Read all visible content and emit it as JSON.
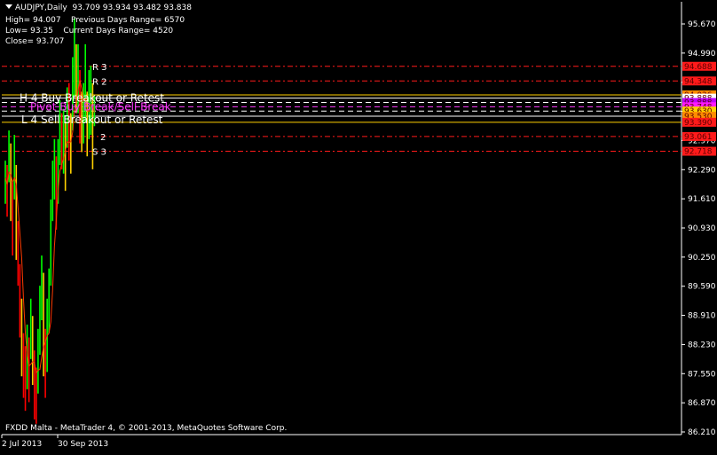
{
  "chart_data": {
    "type": "candlestick",
    "symbol_label": "AUDJPY,Daily",
    "ohlc_header": "93.709 93.934 93.482 93.838",
    "info": {
      "high": "High= 94.007",
      "prev_range": "Previous Days Range= 6570",
      "low": "Low= 93.35",
      "curr_range": "Current Days Range= 4520",
      "close": "Close= 93.707"
    },
    "footer": "FXDD Malta - MetaTrader 4, © 2001-2013, MetaQuotes Software Corp.",
    "x_tick_labels": [
      "2 Jul 2013",
      "30 Sep 2013"
    ],
    "y_ticks": [
      "95.670",
      "94.990",
      "94.310",
      "93.630",
      "92.970",
      "92.290",
      "91.610",
      "90.930",
      "90.250",
      "89.590",
      "88.910",
      "88.230",
      "87.550",
      "86.870",
      "86.210"
    ],
    "ylim": [
      86.21,
      95.67
    ],
    "levels": [
      {
        "label": "R 3",
        "price": 94.688,
        "badge": "94.688",
        "color": "#ff1a1a",
        "style": "dashdot",
        "badge_bg": "#ff1a1a"
      },
      {
        "label": "R 2",
        "price": 94.348,
        "badge": "94.348",
        "color": "#ff1a1a",
        "style": "dashdot",
        "badge_bg": "#ff1a1a"
      },
      {
        "label": "",
        "price": 94.026,
        "badge": "94.026",
        "color": "#ffd000",
        "style": "solid",
        "badge_bg": "#ff8c00"
      },
      {
        "label": "H 4 Buy Breakout or Retest",
        "price": 93.95,
        "badge": "93.888",
        "color": "#ffffff",
        "style": "solid",
        "badge_bg": "#ffffff"
      },
      {
        "label": "",
        "price": 93.85,
        "badge": "93.888",
        "color": "#ffffff",
        "style": "dashed",
        "badge_bg": "#c000ff"
      },
      {
        "label": "Pivot Buy Break/Sell Break",
        "price": 93.75,
        "badge": "93.748",
        "color": "#ff3cff",
        "style": "dashed",
        "badge_bg": "#ff1aff"
      },
      {
        "label": "",
        "price": 93.65,
        "badge": "93.630",
        "color": "#ffffff",
        "style": "dashed",
        "badge_bg": "#ffd000"
      },
      {
        "label": "",
        "price": 93.53,
        "badge": "93.530",
        "color": "#ffffff",
        "style": "solid",
        "badge_bg": "#ff8c00"
      },
      {
        "label": "",
        "price": 93.39,
        "badge": "93.390",
        "color": "#ffd000",
        "style": "solid",
        "badge_bg": "#ff1a1a"
      },
      {
        "label": "L 4 Sell Breakout or Retest",
        "price": 93.45,
        "badge": "",
        "color": "#ffd000",
        "style": "none",
        "badge_bg": ""
      },
      {
        "label": "2",
        "price": 93.06,
        "badge": "93.061",
        "color": "#ff1a1a",
        "style": "dashdot",
        "badge_bg": "#ff1a1a"
      },
      {
        "label": "S 3",
        "price": 92.718,
        "badge": "92.718",
        "color": "#ff1a1a",
        "style": "dashdot",
        "badge_bg": "#ff1a1a"
      }
    ],
    "series": {
      "closes": [
        92.1,
        91.8,
        92.8,
        92.0,
        91.3,
        92.6,
        91.0,
        90.2,
        89.0,
        88.4,
        87.8,
        87.1,
        87.9,
        87.5,
        88.6,
        88.1,
        87.0,
        86.7,
        87.8,
        88.7,
        89.5,
        88.2,
        87.3,
        88.5,
        89.0,
        90.8,
        91.9,
        92.4,
        91.5,
        92.3,
        93.2,
        92.7,
        93.0,
        92.4,
        93.4,
        93.1,
        92.8,
        94.1,
        95.1,
        94.2,
        94.5,
        93.9,
        93.2,
        93.6,
        94.5,
        93.1,
        93.8,
        94.0,
        93.5,
        93.7
      ],
      "highs": [
        92.5,
        92.4,
        93.2,
        92.9,
        92.0,
        93.1,
        92.4,
        91.1,
        90.1,
        89.3,
        88.5,
        88.2,
        88.7,
        88.4,
        89.3,
        88.9,
        88.1,
        87.7,
        88.6,
        89.6,
        90.3,
        89.9,
        88.6,
        89.3,
        90.0,
        91.6,
        92.5,
        93.0,
        92.6,
        93.0,
        93.9,
        93.6,
        93.7,
        93.4,
        94.2,
        94.3,
        93.6,
        94.9,
        95.8,
        95.2,
        95.2,
        94.6,
        94.1,
        94.3,
        95.2,
        94.1,
        94.6,
        94.7,
        94.3,
        94.0
      ],
      "lows": [
        91.5,
        91.2,
        92.0,
        91.1,
        90.3,
        91.6,
        90.2,
        89.6,
        88.4,
        87.5,
        87.0,
        86.7,
        87.2,
        86.9,
        87.9,
        87.3,
        86.5,
        86.4,
        87.1,
        88.0,
        88.8,
        87.5,
        87.0,
        87.6,
        88.5,
        89.6,
        91.1,
        91.6,
        90.9,
        91.5,
        92.4,
        92.3,
        92.2,
        91.8,
        92.8,
        92.5,
        92.2,
        93.2,
        94.0,
        93.6,
        93.6,
        92.9,
        92.7,
        92.9,
        93.4,
        92.6,
        93.0,
        93.1,
        92.3,
        93.3
      ]
    },
    "colors": {
      "bull": "#00ff00",
      "bear": "#ff0000",
      "mix": "#ffd000",
      "ma": "#ff3b00",
      "grid": "#1a1a1a",
      "axis": "#ffffff"
    }
  }
}
